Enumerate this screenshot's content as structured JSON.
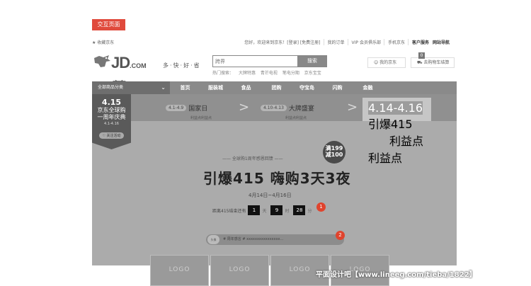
{
  "tag_button": "交互页面",
  "topbar": {
    "favorite": "★ 收藏京东",
    "links": [
      "您好，欢迎来到京东！[登录] [免费注册]",
      "我的订单",
      "VIP 会员俱乐部",
      "手机京东",
      "客户服务",
      "网站导航"
    ]
  },
  "logo": {
    "text": "JD",
    "dotcom": ".COM",
    "cn": "京东",
    "slogan": "多·快·好·省"
  },
  "search": {
    "placeholder": "跨界",
    "button": "搜索",
    "hotwords": [
      "热门搜索：",
      "大牌特惠",
      "青芒电视",
      "笔电分期",
      "京东宝宝"
    ]
  },
  "header_right": {
    "myjd": "我的京东",
    "cart": "去购物车结算",
    "cart_count": "0"
  },
  "nav": {
    "category": "全部商品分类",
    "chevron": "⌄",
    "items": [
      "首页",
      "服装城",
      "食品",
      "团购",
      "夺宝岛",
      "闪购",
      "金融"
    ]
  },
  "ribbon": {
    "num": "4.15",
    "title_line1": "京东全球购",
    "title_line2": "一周年庆典",
    "date": "4.1-4.16",
    "follow": "♡ 关注活动"
  },
  "steps": [
    {
      "range": "4.1-4.9",
      "title": "国家日",
      "sub": "利益点利益点"
    },
    {
      "range": "4.10-4.13",
      "title": "大牌盛宴",
      "sub": "利益点利益点"
    },
    {
      "range": "4.14-4.16",
      "title": "引爆415",
      "sub": "利益点利益点"
    }
  ],
  "promo_circle": {
    "line1": "满199",
    "line2": "减100"
  },
  "sub_headline": "—— 全球购1周年感恩回馈 ——",
  "headline": "引爆415 嗨购3天3夜",
  "date_range": "4月14日~4月16日",
  "countdown": {
    "label": "距离415结束还有",
    "days": "1",
    "day_unit": "天",
    "hours": "9",
    "hour_unit": "时",
    "minutes": "28",
    "minute_unit": "分"
  },
  "markers": [
    "1",
    "2"
  ],
  "comment": {
    "avatar": "头像",
    "text": "# 周年感言 # xxxxxxxxxxxxxxxx..."
  },
  "logos": [
    "LOGO",
    "LOGO",
    "LOGO",
    "LOGO"
  ],
  "watermark": "平面设计吧【www.lineeg.com/tieba/1822】"
}
